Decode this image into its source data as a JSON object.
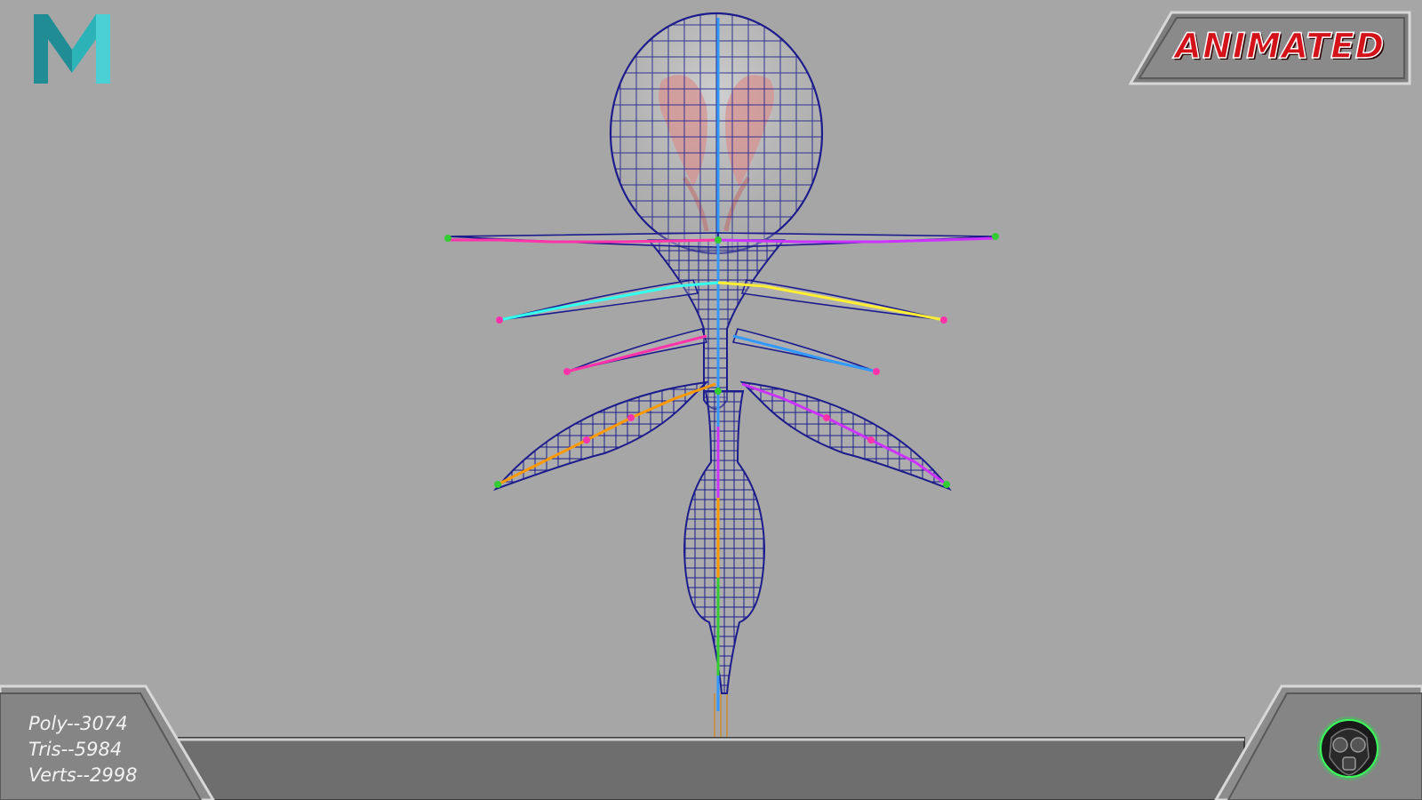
{
  "viewport": {
    "background": "#a6a6a6",
    "wire_color": "#1c1c8c",
    "bone_colors": [
      "#33cc33",
      "#ff33aa",
      "#3399ff",
      "#ff9900",
      "#cc33ff",
      "#ffee33",
      "#33ffee"
    ]
  },
  "logos": {
    "maya": "maya-logo-icon",
    "gasmask": "gasmask-logo-icon",
    "maya_color": "#2bb3b8"
  },
  "badge": {
    "label": "ANIMATED",
    "text_color": "#d4121a"
  },
  "stats": {
    "poly": "Poly--3074",
    "tris": "Tris--5984",
    "verts": "Verts--2998"
  }
}
